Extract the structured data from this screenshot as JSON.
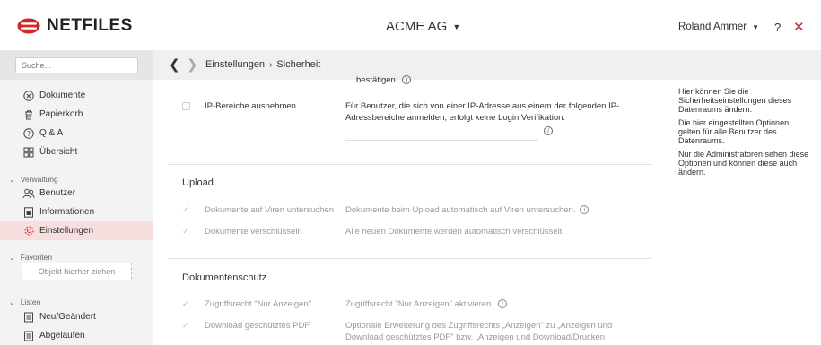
{
  "header": {
    "logo_text": "NETFILES",
    "room_title": "ACME AG",
    "user_name": "Roland Ammer",
    "help_label": "?",
    "close_label": "✕"
  },
  "search": {
    "placeholder": "Suche..."
  },
  "breadcrumb": {
    "items": [
      "Einstellungen",
      "Sicherheit"
    ],
    "separator": "›"
  },
  "sidebar": {
    "items": [
      {
        "label": "Dokumente",
        "icon": "circle-x-icon"
      },
      {
        "label": "Papierkorb",
        "icon": "trash-icon"
      },
      {
        "label": "Q & A",
        "icon": "question-circle-icon"
      },
      {
        "label": "Übersicht",
        "icon": "grid-icon"
      }
    ],
    "verwaltung": {
      "title": "Verwaltung",
      "items": [
        {
          "label": "Benutzer",
          "icon": "users-icon"
        },
        {
          "label": "Informationen",
          "icon": "info-doc-icon"
        },
        {
          "label": "Einstellungen",
          "icon": "gear-icon",
          "active": true
        }
      ]
    },
    "favoriten": {
      "title": "Favoriten",
      "drop_label": "Objekt hierher ziehen"
    },
    "listen": {
      "title": "Listen",
      "items": [
        {
          "label": "Neu/Geändert",
          "icon": "list-icon"
        },
        {
          "label": "Abgelaufen",
          "icon": "list-icon"
        }
      ]
    }
  },
  "content": {
    "top_fragment": "bestätigen.",
    "ip_row": {
      "label": "IP-Bereiche ausnehmen",
      "description": "Für Benutzer, die sich von einer IP-Adresse aus einem der folgenden IP-Adressbereiche anmelden, erfolgt keine Login Verifikation:",
      "checked": false
    },
    "upload": {
      "heading": "Upload",
      "rows": [
        {
          "label": "Dokumente auf Viren untersuchen",
          "description": "Dokumente beim Upload automatisch auf Viren untersuchen.",
          "info": true,
          "checked": true
        },
        {
          "label": "Dokumente verschlüsseln",
          "description": "Alle neuen Dokumente werden automatisch verschlüsselt.",
          "info": false,
          "checked": true
        }
      ]
    },
    "dokumentenschutz": {
      "heading": "Dokumentenschutz",
      "rows": [
        {
          "label": "Zugriffsrecht \"Nur Anzeigen\"",
          "description": "Zugriffsrecht \"Nur Anzeigen\" aktivieren.",
          "info": true,
          "checked": true
        },
        {
          "label": "Download geschütztes PDF",
          "description": "Optionale Erweiterung des Zugriffsrechts „Anzeigen\" zu „Anzeigen und Download geschütztes PDF\" bzw. „Anzeigen und Download/Drucken",
          "info": false,
          "checked": true
        }
      ]
    }
  },
  "help_panel": {
    "paragraphs": [
      "Hier können Sie die Sicherheitseinstellungen dieses Datenraums ändern.",
      "Die hier eingestellten Optionen gelten für alle Benutzer des Datenraums.",
      "Nur die Administratoren sehen diese Optionen und können diese auch ändern."
    ]
  },
  "colors": {
    "brand_red": "#d0262c",
    "active_bg": "#f7dfe0",
    "sidebar_bg": "#f3f3f3"
  }
}
